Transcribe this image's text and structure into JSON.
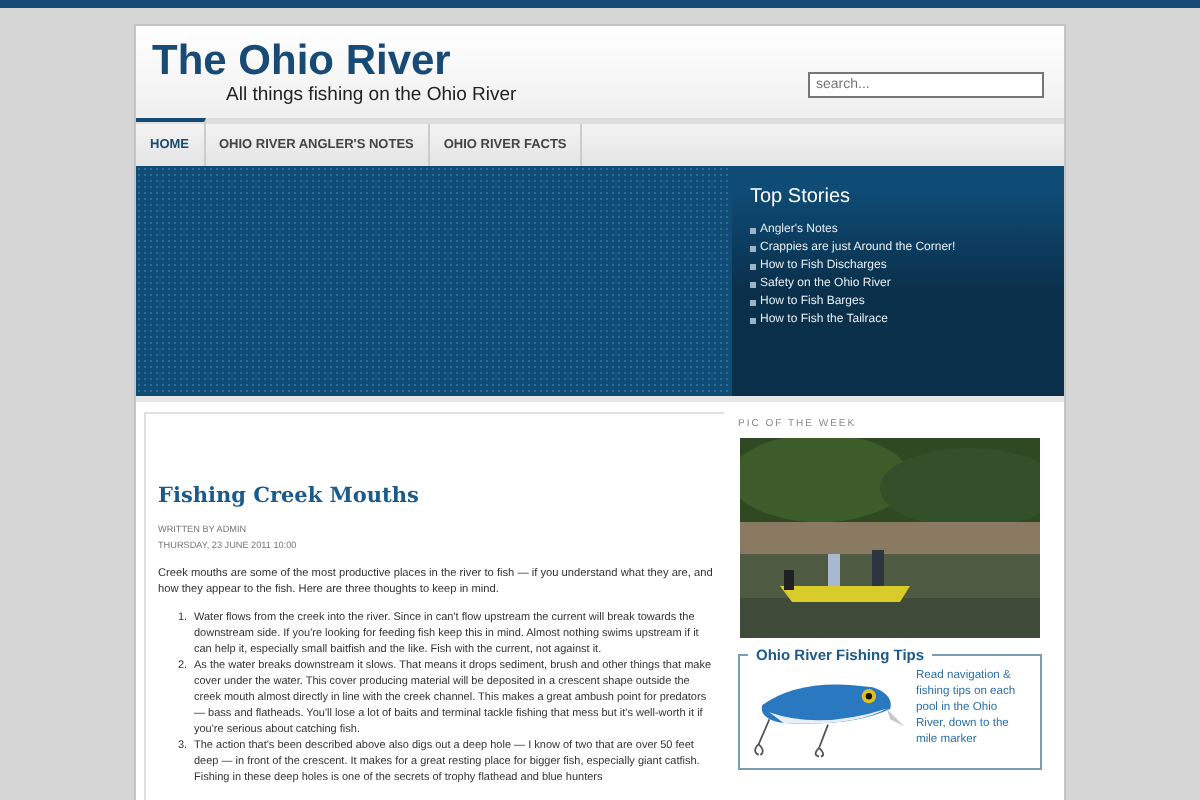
{
  "site": {
    "title": "The Ohio River",
    "tagline": "All things fishing on the Ohio River"
  },
  "search": {
    "placeholder": "search..."
  },
  "nav": [
    {
      "label": "HOME",
      "selected": true
    },
    {
      "label": "OHIO RIVER ANGLER'S NOTES",
      "selected": false
    },
    {
      "label": "OHIO RIVER FACTS",
      "selected": false
    }
  ],
  "top_stories": {
    "title": "Top Stories",
    "items": [
      "Angler's Notes",
      "Crappies are just Around the Corner!",
      "How to Fish Discharges",
      "Safety on the Ohio River",
      "How to Fish Barges",
      "How to Fish the Tailrace"
    ]
  },
  "article": {
    "title": "Fishing Creek Mouths",
    "author": "WRITTEN BY ADMIN",
    "date": "THURSDAY, 23 JUNE 2011 10:00",
    "intro": "Creek mouths are some of the most productive places in the river to fish — if you understand what they are, and how they appear to the fish. Here are three thoughts to keep in mind.",
    "points": [
      {
        "number": "1.",
        "text": "Water flows from the creek into the river. Since in can't flow upstream the current will break towards the downstream side. If you're looking for feeding fish keep this in mind. Almost nothing swims upstream if it can help it, especially small baitfish and the like. Fish with the current, not against it."
      },
      {
        "number": "2.",
        "text": "As the water breaks downstream it slows. That means it drops sediment, brush and other things that make cover under the water. This cover producing material will be deposited in a crescent shape outside the creek mouth almost directly in line with the creek channel. This makes a great ambush point for predators — bass and flatheads. You'll lose a lot of baits and terminal tackle fishing that mess but it's well-worth it if you're serious about catching fish."
      },
      {
        "number": "3.",
        "text": "The action that's been described above also digs out a deep hole — I know of two that are over 50 feet deep — in front of the crescent. It makes for a great resting place for bigger fish, especially giant catfish. Fishing in these deep holes is one of the secrets of trophy flathead and blue hunters"
      }
    ]
  },
  "sidebar": {
    "pic_heading": "PIC OF THE WEEK",
    "tips": {
      "title": "Ohio River Fishing Tips",
      "text": "Read navigation & fishing tips on each pool in the Ohio River, down to the mile marker"
    }
  }
}
